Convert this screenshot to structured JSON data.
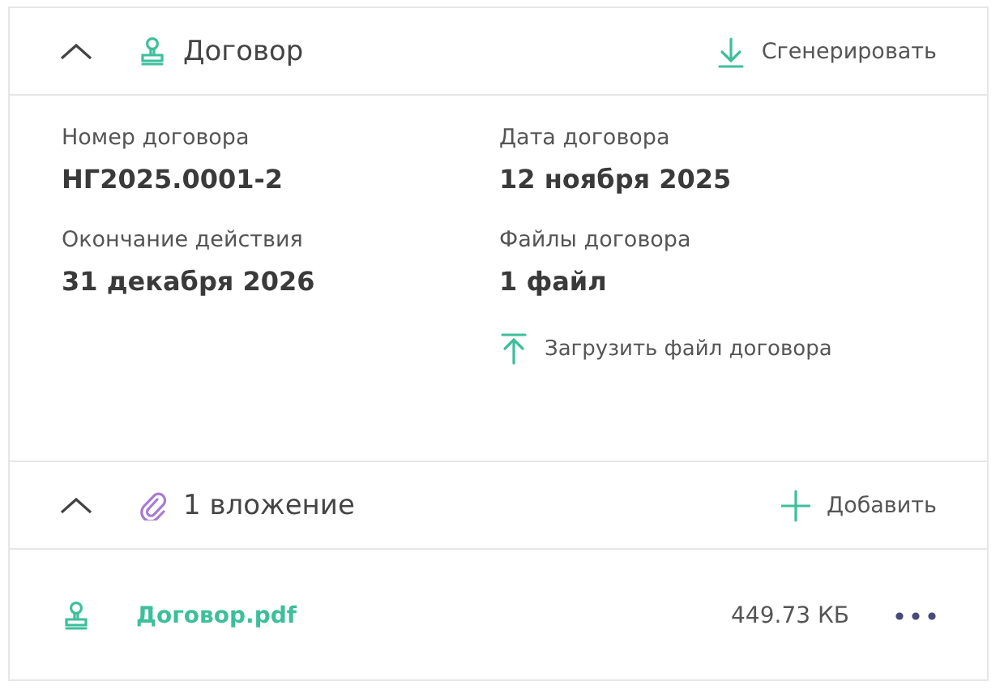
{
  "contract": {
    "title": "Договор",
    "expanded": true,
    "action": "Сгенерировать",
    "fields": [
      {
        "label": "Номер договора",
        "value": "НГ2025.0001-2"
      },
      {
        "label": "Дата договора",
        "value": "12 ноября 2025"
      },
      {
        "label": "Окончание действия",
        "value": "31 декабря 2026"
      },
      {
        "label": "Файлы договора",
        "value": "1 файл"
      }
    ],
    "upload": "Загрузить файл договора"
  },
  "attachments": {
    "title": "1 вложение",
    "expanded": true,
    "action": "Добавить",
    "files": [
      {
        "name": "Договор.pdf",
        "size": "449.73 КБ"
      }
    ]
  }
}
